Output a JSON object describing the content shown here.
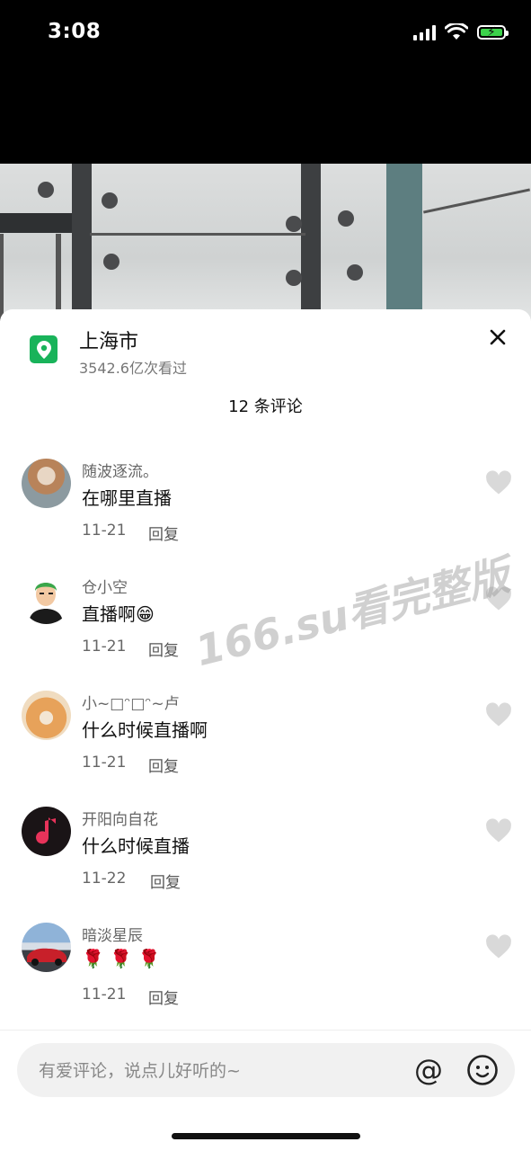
{
  "status_bar": {
    "time": "3:08"
  },
  "location": {
    "title": "上海市",
    "views": "3542.6亿次看过"
  },
  "comment_count": "12 条评论",
  "comments": [
    {
      "user": "随波逐流。",
      "text": "在哪里直播",
      "date": "11-21",
      "reply": "回复"
    },
    {
      "user": "仓小空",
      "text": "直播啊😁",
      "date": "11-21",
      "reply": "回复"
    },
    {
      "user": "小~□ᵔ□ᵔ~卢",
      "text": "什么时候直播啊",
      "date": "11-21",
      "reply": "回复"
    },
    {
      "user": "开阳向自花",
      "text": "什么时候直播",
      "date": "11-22",
      "reply": "回复"
    },
    {
      "user": "暗淡星辰",
      "text": "🌹 🌹 🌹",
      "date": "11-21",
      "reply": "回复"
    }
  ],
  "watermark": "166.su看完整版",
  "input": {
    "placeholder": "有爱评论，说点儿好听的~"
  },
  "icons": {
    "at": "@"
  },
  "colors": {
    "accent_green": "#19b35a",
    "battery_green": "#3cd24b"
  }
}
